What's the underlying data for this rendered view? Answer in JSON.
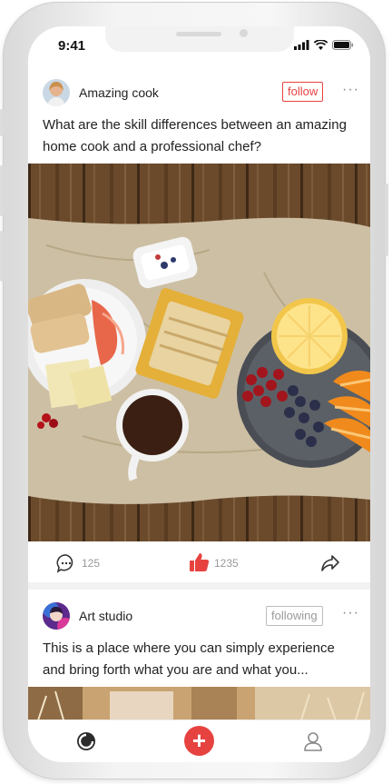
{
  "status_bar": {
    "time": "9:41"
  },
  "posts": [
    {
      "author": "Amazing cook",
      "follow_label": "follow",
      "follow_color": "#e64340",
      "more": "···",
      "text": "What are the skill differences between an amazing home cook and a professional chef?",
      "comments": "125",
      "likes": "1235"
    },
    {
      "author": "Art studio",
      "follow_label": "following",
      "follow_color": "#999999",
      "more": "···",
      "text": "This is a place where you can simply experience and bring forth what you are and what you..."
    }
  ],
  "tabbar": {
    "add_label": "+"
  },
  "colors": {
    "accent": "#e64340",
    "muted": "#999999"
  }
}
